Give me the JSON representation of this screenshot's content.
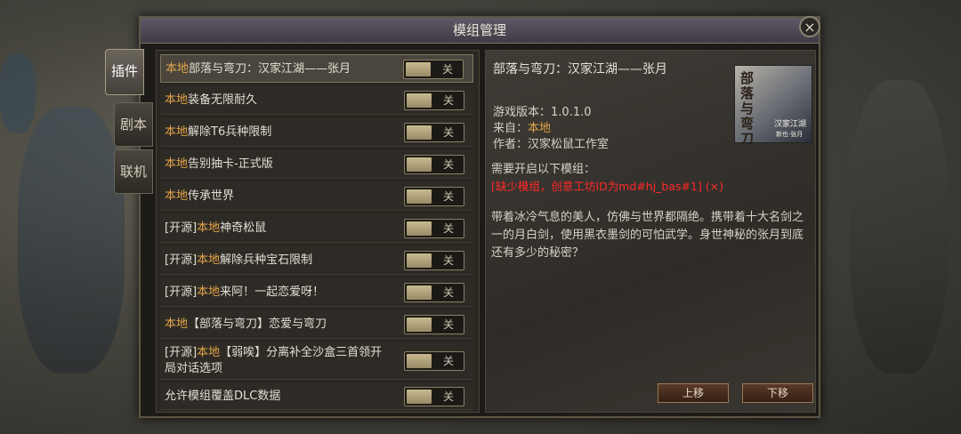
{
  "window": {
    "title": "模组管理",
    "close_glyph": "×"
  },
  "side_tabs": [
    {
      "label": "插件",
      "active": true
    },
    {
      "label": "剧本",
      "active": false
    },
    {
      "label": "联机",
      "active": false
    }
  ],
  "mod_list": [
    {
      "prefix": "",
      "local": "本地",
      "name": "部落与弯刀：汉家江湖——张月",
      "name2": "",
      "toggle": "关",
      "selected": true
    },
    {
      "prefix": "",
      "local": "本地",
      "name": "装备无限耐久",
      "name2": "",
      "toggle": "关"
    },
    {
      "prefix": "",
      "local": "本地",
      "name": "解除T6兵种限制",
      "name2": "",
      "toggle": "关"
    },
    {
      "prefix": "",
      "local": "本地",
      "name": "告别抽卡-正式版",
      "name2": "",
      "toggle": "关"
    },
    {
      "prefix": "",
      "local": "本地",
      "name": "传承世界",
      "name2": "",
      "toggle": "关"
    },
    {
      "prefix": "[开源]",
      "local": "本地",
      "name": "神奇松鼠",
      "name2": "",
      "toggle": "关"
    },
    {
      "prefix": "[开源]",
      "local": "本地",
      "name": "解除兵种宝石限制",
      "name2": "",
      "toggle": "关"
    },
    {
      "prefix": "[开源]",
      "local": "本地",
      "name": "来阿！一起恋爱呀！",
      "name2": "",
      "toggle": "关"
    },
    {
      "prefix": "",
      "local": "本地",
      "name": "【部落与弯刀】恋爱与弯刀",
      "name2": "",
      "toggle": "关"
    },
    {
      "prefix": "[开源]",
      "local": "本地",
      "name": "【弱唉】分离补全沙盒三首领开",
      "name2": "局对话选项",
      "toggle": "关"
    }
  ],
  "dlc_row": {
    "label": "允许模组覆盖DLC数据",
    "toggle": "关"
  },
  "detail": {
    "title": "部落与弯刀：汉家江湖——张月",
    "version_label": "游戏版本：",
    "version": "1.0.1.0",
    "source_label": "来自：",
    "source": "本地",
    "author_label": "作者：",
    "author": "汉家松鼠工作室",
    "requires_label": "需要开启以下模组：",
    "missing": "[缺少模组，创意工坊ID为md#hj_bas#1] (×)",
    "description": "带着冰冷气息的美人，仿佛与世界都隔绝。携带着十大名剑之一的月白剑，使用黑衣墨剑的可怕武学。身世神秘的张月到底还有多少的秘密？",
    "cover": {
      "title_chars": "部落与弯刀",
      "sub": "汉家江湖",
      "sub2": "新也·张月"
    },
    "btn_up": "上移",
    "btn_down": "下移"
  },
  "colors": {
    "local_orange": "#e4a447",
    "warning_red": "#ff2a2a"
  }
}
